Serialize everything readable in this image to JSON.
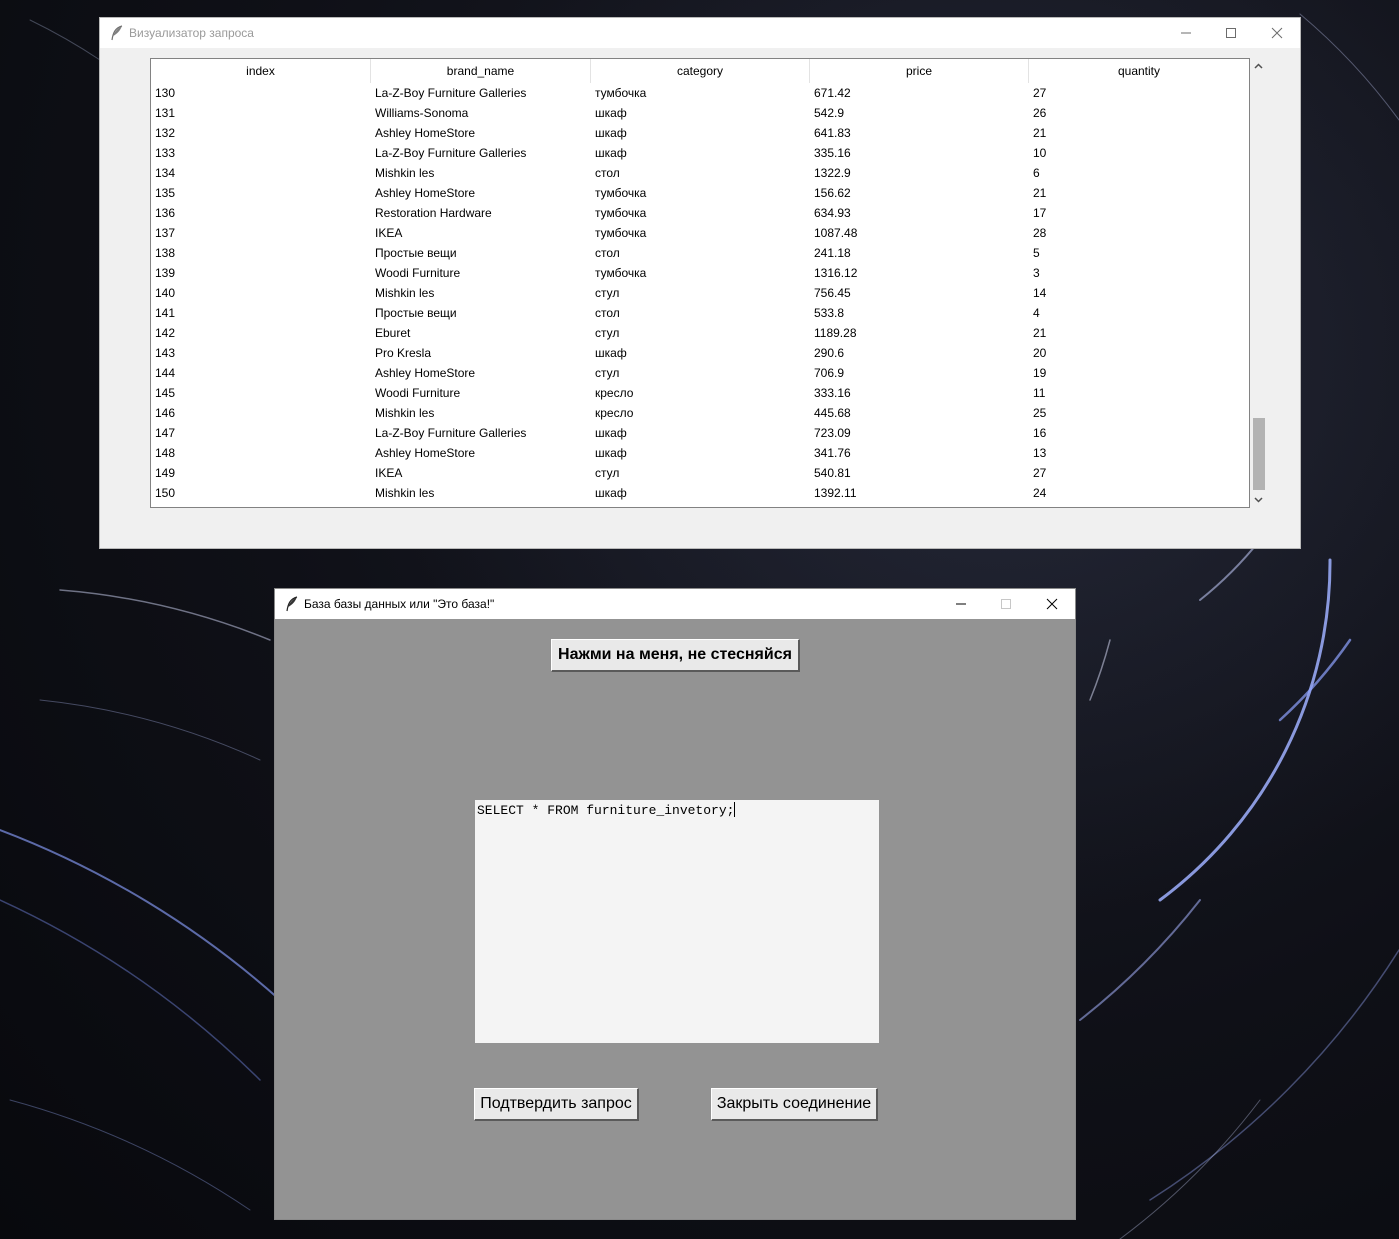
{
  "query_window": {
    "title": "Визуализатор запроса",
    "columns": [
      "index",
      "brand_name",
      "category",
      "price",
      "quantity"
    ],
    "rows": [
      [
        "130",
        "La-Z-Boy Furniture Galleries",
        "тумбочка",
        "671.42",
        "27"
      ],
      [
        "131",
        "Williams-Sonoma",
        "шкаф",
        "542.9",
        "26"
      ],
      [
        "132",
        "Ashley HomeStore",
        "шкаф",
        "641.83",
        "21"
      ],
      [
        "133",
        "La-Z-Boy Furniture Galleries",
        "шкаф",
        "335.16",
        "10"
      ],
      [
        "134",
        "Mishkin les",
        "стол",
        "1322.9",
        "6"
      ],
      [
        "135",
        "Ashley HomeStore",
        "тумбочка",
        "156.62",
        "21"
      ],
      [
        "136",
        "Restoration Hardware",
        "тумбочка",
        "634.93",
        "17"
      ],
      [
        "137",
        "IKEA",
        "тумбочка",
        "1087.48",
        "28"
      ],
      [
        "138",
        "Простые вещи",
        "стол",
        "241.18",
        "5"
      ],
      [
        "139",
        "Woodi Furniture",
        "тумбочка",
        "1316.12",
        "3"
      ],
      [
        "140",
        "Mishkin les",
        "стул",
        "756.45",
        "14"
      ],
      [
        "141",
        "Простые вещи",
        "стол",
        "533.8",
        "4"
      ],
      [
        "142",
        "Eburet",
        "стул",
        "1189.28",
        "21"
      ],
      [
        "143",
        "Pro Kresla",
        "шкаф",
        "290.6",
        "20"
      ],
      [
        "144",
        "Ashley HomeStore",
        "стул",
        "706.9",
        "19"
      ],
      [
        "145",
        "Woodi Furniture",
        "кресло",
        "333.16",
        "11"
      ],
      [
        "146",
        "Mishkin les",
        "кресло",
        "445.68",
        "25"
      ],
      [
        "147",
        "La-Z-Boy Furniture Galleries",
        "шкаф",
        "723.09",
        "16"
      ],
      [
        "148",
        "Ashley HomeStore",
        "шкаф",
        "341.76",
        "13"
      ],
      [
        "149",
        "IKEA",
        "стул",
        "540.81",
        "27"
      ],
      [
        "150",
        "Mishkin les",
        "шкаф",
        "1392.11",
        "24"
      ]
    ],
    "scroll_position": 0.95
  },
  "main_window": {
    "title": "База базы данных или \"Это база!\"",
    "top_button_label": "Нажми на меня, не стесняйся",
    "query_text": "SELECT * FROM furniture_invetory;",
    "confirm_button_label": "Подтвердить запрос",
    "close_button_label": "Закрыть соединение"
  },
  "colors": {
    "main_window_bg": "#939393",
    "button_bg": "#e9e9e9",
    "query_box_bg": "#f4f4f4"
  },
  "icons": [
    "feather-icon",
    "minimize-icon",
    "maximize-icon",
    "close-icon",
    "scroll-up-icon",
    "scroll-down-icon"
  ]
}
